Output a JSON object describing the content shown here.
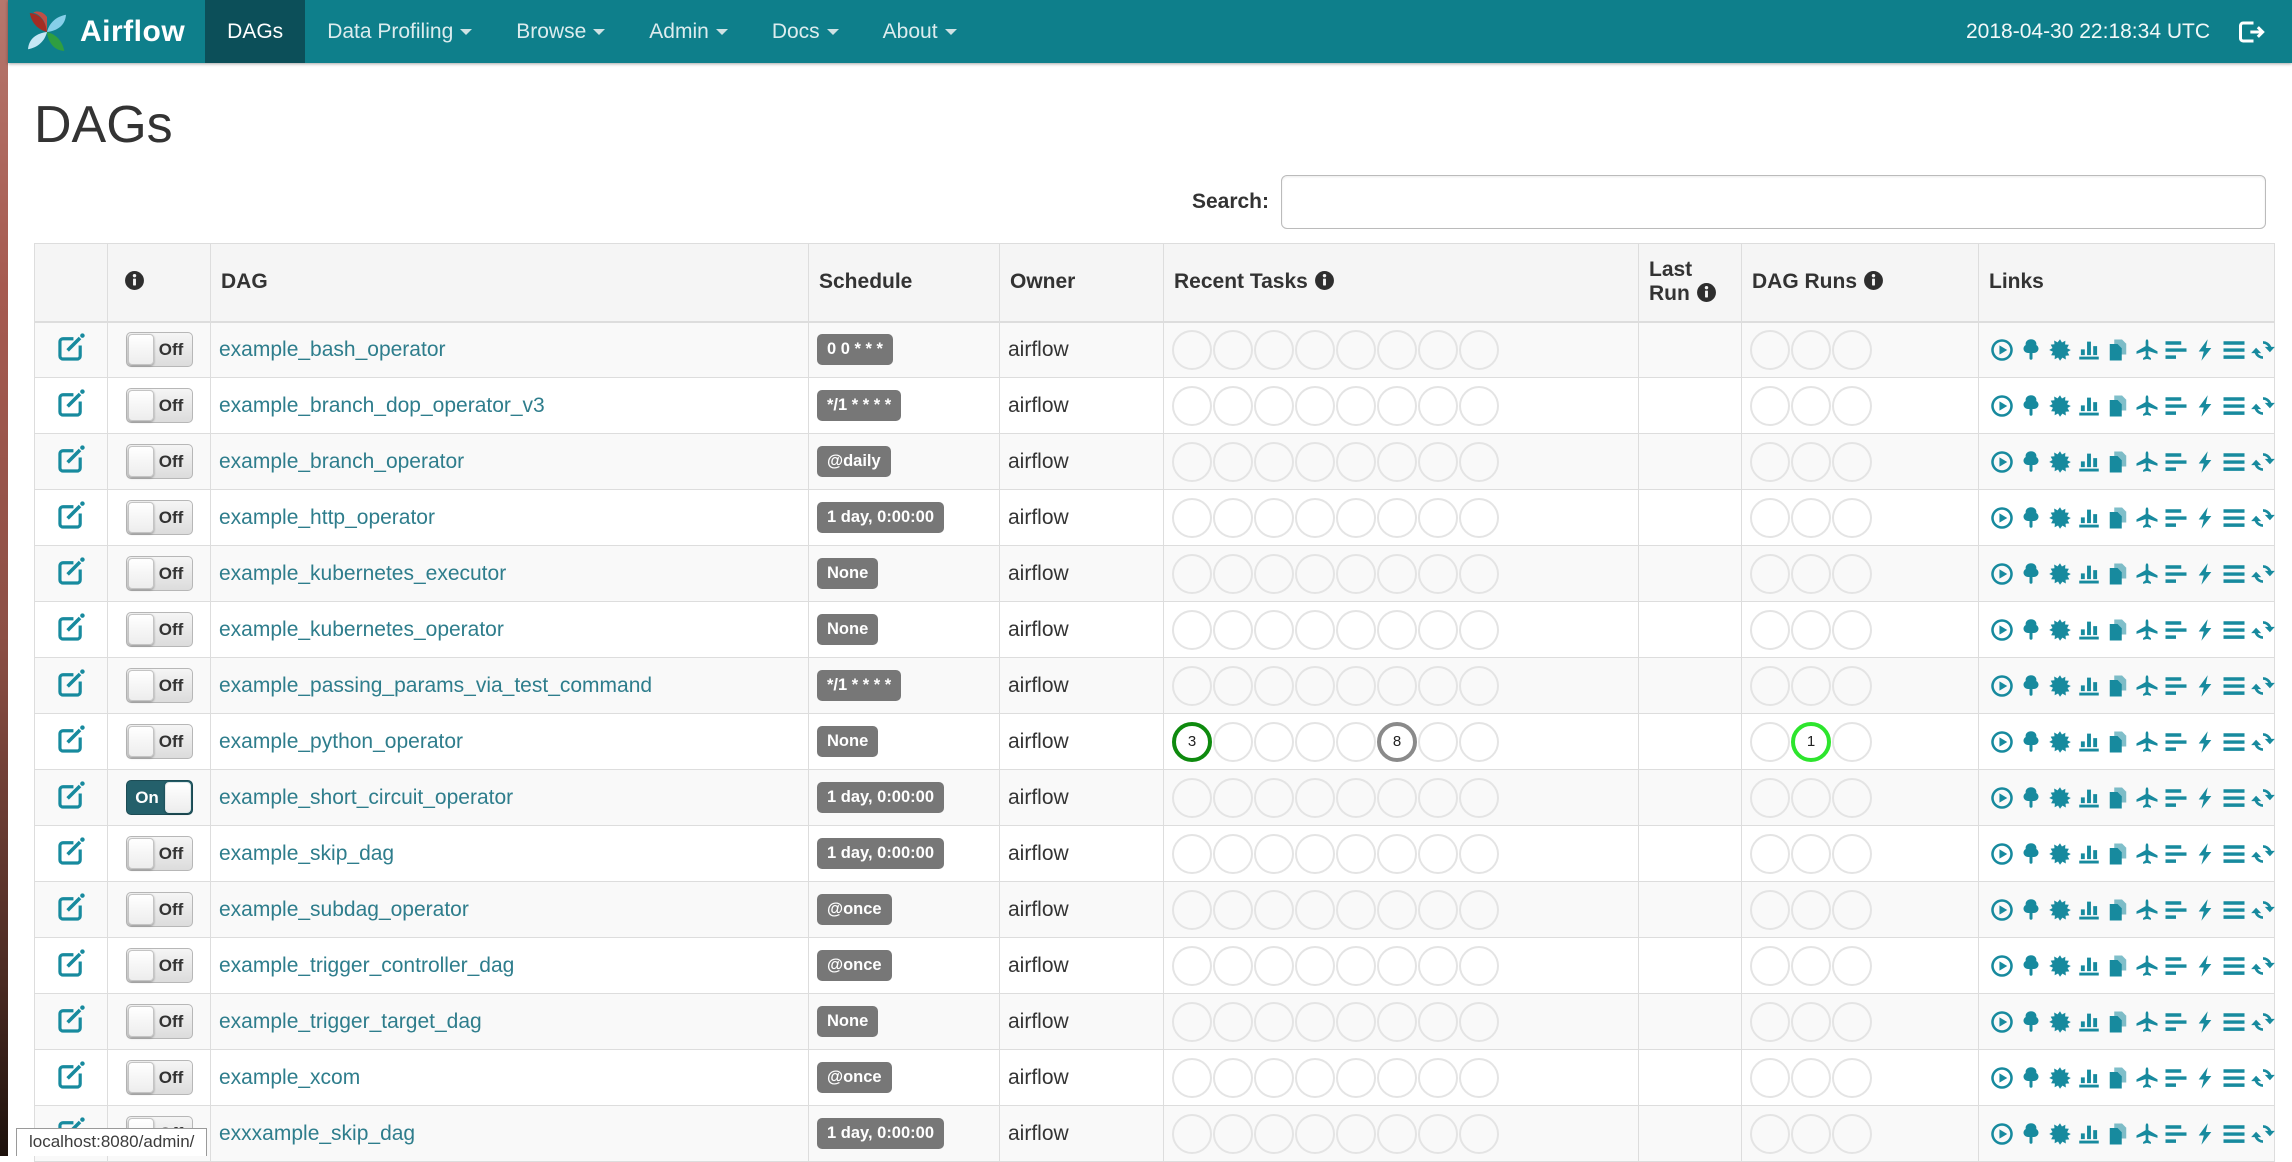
{
  "navbar": {
    "brand": "Airflow",
    "items": [
      {
        "label": "DAGs",
        "active": true,
        "caret": false
      },
      {
        "label": "Data Profiling",
        "active": false,
        "caret": true
      },
      {
        "label": "Browse",
        "active": false,
        "caret": true
      },
      {
        "label": "Admin",
        "active": false,
        "caret": true
      },
      {
        "label": "Docs",
        "active": false,
        "caret": true
      },
      {
        "label": "About",
        "active": false,
        "caret": true
      }
    ],
    "clock": "2018-04-30 22:18:34 UTC"
  },
  "page": {
    "title": "DAGs",
    "search_label": "Search:",
    "search_value": "",
    "status_bar": "localhost:8080/admin/"
  },
  "colors": {
    "navbar_bg": "#0E7F8B",
    "navbar_active_bg": "#0C4F59",
    "accent": "#178A9E",
    "link": "#2E7D8C",
    "toggle_on_bg": "#24606B",
    "badge_bg": "#777777",
    "circle_empty_border": "#E4E4E4",
    "circle_success": "#0E8A0E",
    "circle_none": "#8A8A8A",
    "circle_running": "#2DE52D"
  },
  "table": {
    "headers": {
      "dag": "DAG",
      "schedule": "Schedule",
      "owner": "Owner",
      "recent_tasks": "Recent Tasks",
      "last_run": "Last Run",
      "dag_runs": "DAG Runs",
      "links": "Links"
    },
    "recent_task_slots": 8,
    "dag_run_slots": 3,
    "links_icons": [
      "trigger-dag",
      "tree-view",
      "graph-view",
      "task-duration",
      "task-tries",
      "landing-times",
      "gantt",
      "code",
      "logs",
      "refresh"
    ],
    "rows": [
      {
        "dag": "example_bash_operator",
        "toggle": "Off",
        "schedule": "0 0 * * *",
        "owner": "airflow",
        "last_run": "",
        "recent_tasks": [],
        "dag_runs": []
      },
      {
        "dag": "example_branch_dop_operator_v3",
        "toggle": "Off",
        "schedule": "*/1 * * * *",
        "owner": "airflow",
        "last_run": "",
        "recent_tasks": [],
        "dag_runs": []
      },
      {
        "dag": "example_branch_operator",
        "toggle": "Off",
        "schedule": "@daily",
        "owner": "airflow",
        "last_run": "",
        "recent_tasks": [],
        "dag_runs": []
      },
      {
        "dag": "example_http_operator",
        "toggle": "Off",
        "schedule": "1 day, 0:00:00",
        "owner": "airflow",
        "last_run": "",
        "recent_tasks": [],
        "dag_runs": []
      },
      {
        "dag": "example_kubernetes_executor",
        "toggle": "Off",
        "schedule": "None",
        "owner": "airflow",
        "last_run": "",
        "recent_tasks": [],
        "dag_runs": []
      },
      {
        "dag": "example_kubernetes_operator",
        "toggle": "Off",
        "schedule": "None",
        "owner": "airflow",
        "last_run": "",
        "recent_tasks": [],
        "dag_runs": []
      },
      {
        "dag": "example_passing_params_via_test_command",
        "toggle": "Off",
        "schedule": "*/1 * * * *",
        "owner": "airflow",
        "last_run": "",
        "recent_tasks": [],
        "dag_runs": []
      },
      {
        "dag": "example_python_operator",
        "toggle": "Off",
        "schedule": "None",
        "owner": "airflow",
        "last_run": "",
        "recent_tasks": [
          {
            "slot": 0,
            "count": "3",
            "state": "success"
          },
          {
            "slot": 5,
            "count": "8",
            "state": "none"
          }
        ],
        "dag_runs": [
          {
            "slot": 1,
            "count": "1",
            "state": "running"
          }
        ]
      },
      {
        "dag": "example_short_circuit_operator",
        "toggle": "On",
        "schedule": "1 day, 0:00:00",
        "owner": "airflow",
        "last_run": "",
        "recent_tasks": [],
        "dag_runs": []
      },
      {
        "dag": "example_skip_dag",
        "toggle": "Off",
        "schedule": "1 day, 0:00:00",
        "owner": "airflow",
        "last_run": "",
        "recent_tasks": [],
        "dag_runs": []
      },
      {
        "dag": "example_subdag_operator",
        "toggle": "Off",
        "schedule": "@once",
        "owner": "airflow",
        "last_run": "",
        "recent_tasks": [],
        "dag_runs": []
      },
      {
        "dag": "example_trigger_controller_dag",
        "toggle": "Off",
        "schedule": "@once",
        "owner": "airflow",
        "last_run": "",
        "recent_tasks": [],
        "dag_runs": []
      },
      {
        "dag": "example_trigger_target_dag",
        "toggle": "Off",
        "schedule": "None",
        "owner": "airflow",
        "last_run": "",
        "recent_tasks": [],
        "dag_runs": []
      },
      {
        "dag": "example_xcom",
        "toggle": "Off",
        "schedule": "@once",
        "owner": "airflow",
        "last_run": "",
        "recent_tasks": [],
        "dag_runs": []
      },
      {
        "dag": "exxxample_skip_dag",
        "toggle": "Off",
        "schedule": "1 day, 0:00:00",
        "owner": "airflow",
        "last_run": "",
        "recent_tasks": [],
        "dag_runs": []
      }
    ]
  }
}
